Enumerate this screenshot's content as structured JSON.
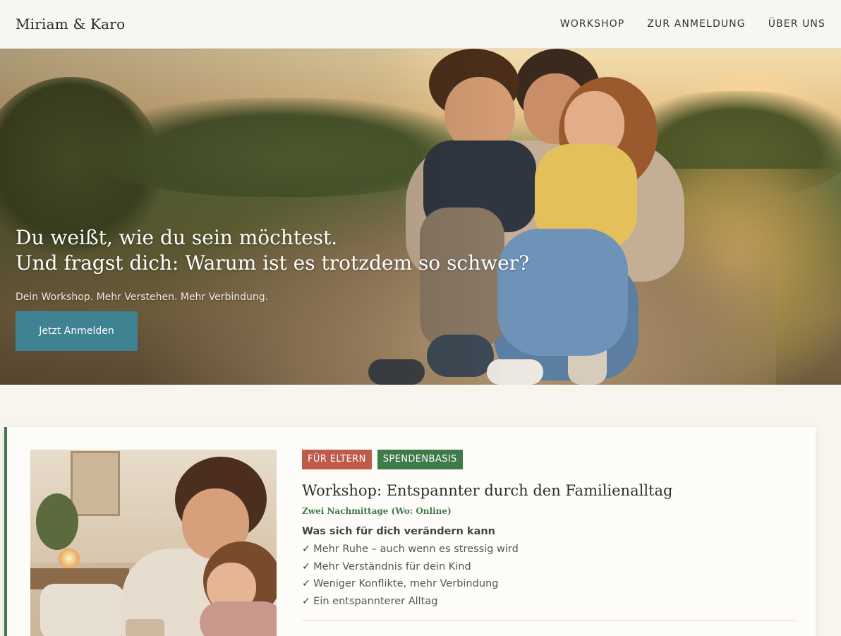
{
  "header": {
    "brand": "Miriam & Karo",
    "nav": [
      {
        "label": "WORKSHOP"
      },
      {
        "label": "ZUR ANMELDUNG"
      },
      {
        "label": "ÜBER UNS"
      }
    ]
  },
  "hero": {
    "title_line1": "Du weißt, wie du sein möchtest.",
    "title_line2": "Und fragst dich: Warum ist es trotzdem so schwer?",
    "subtitle": "Dein Workshop. Mehr Verstehen. Mehr Verbindung.",
    "cta_label": "Jetzt Anmelden"
  },
  "workshop": {
    "tags": [
      {
        "label": "FÜR ELTERN",
        "color": "#c05b4b"
      },
      {
        "label": "SPENDENBASIS",
        "color": "#3e7b49"
      }
    ],
    "title": "Workshop: Entspannter durch den Familienalltag",
    "meta": "Zwei Nachmittage (Wo: Online)",
    "benefits_title": "Was sich für dich verändern kann",
    "benefits": [
      "Mehr Ruhe – auch wenn es stressig wird",
      "Mehr Verständnis für dein Kind",
      "Weniger Konflikte, mehr Verbindung",
      "Ein entspannterer Alltag"
    ],
    "check_glyph": "✓"
  },
  "colors": {
    "accent_teal": "#3f8294",
    "accent_green": "#3e7b49",
    "accent_red": "#c05b4b",
    "background": "#f8f5ee"
  }
}
